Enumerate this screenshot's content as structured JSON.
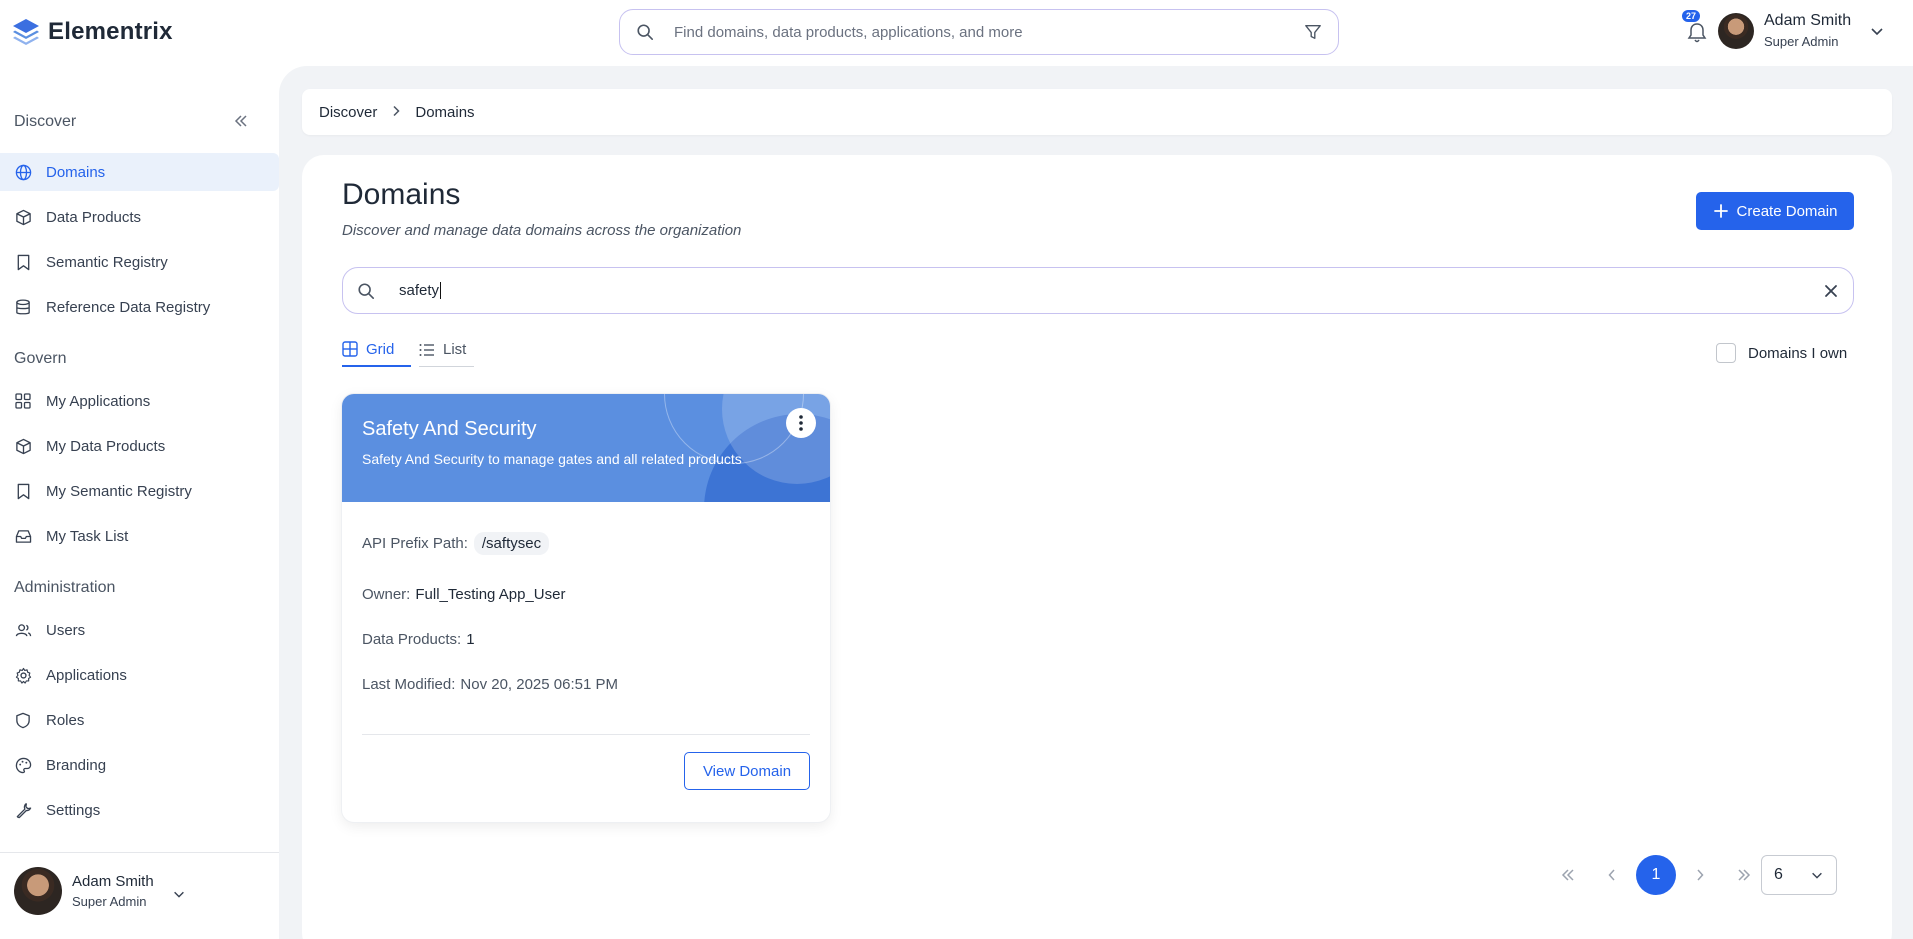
{
  "app": {
    "name": "Elementrix"
  },
  "global_search": {
    "placeholder": "Find domains, data products, applications, and more"
  },
  "notifications": {
    "count": "27"
  },
  "user": {
    "name": "Adam Smith",
    "role": "Super Admin"
  },
  "sidebar": {
    "sections": [
      {
        "title": "Discover"
      },
      {
        "title": "Govern"
      },
      {
        "title": "Administration"
      }
    ],
    "discover": [
      {
        "label": "Domains",
        "icon": "globe-icon",
        "active": true
      },
      {
        "label": "Data Products",
        "icon": "cube-icon"
      },
      {
        "label": "Semantic Registry",
        "icon": "bookmark-icon"
      },
      {
        "label": "Reference Data Registry",
        "icon": "database-icon"
      }
    ],
    "govern": [
      {
        "label": "My Applications",
        "icon": "apps-grid-icon"
      },
      {
        "label": "My Data Products",
        "icon": "cube-icon"
      },
      {
        "label": "My Semantic Registry",
        "icon": "bookmark-icon"
      },
      {
        "label": "My Task List",
        "icon": "inbox-icon"
      }
    ],
    "administration": [
      {
        "label": "Users",
        "icon": "users-icon"
      },
      {
        "label": "Applications",
        "icon": "gear-cog-icon"
      },
      {
        "label": "Roles",
        "icon": "shield-icon"
      },
      {
        "label": "Branding",
        "icon": "palette-icon"
      },
      {
        "label": "Settings",
        "icon": "wrench-icon"
      }
    ]
  },
  "breadcrumb": [
    "Discover",
    "Domains"
  ],
  "page": {
    "title": "Domains",
    "subtitle": "Discover and manage data domains across the organization",
    "create_label": "Create Domain"
  },
  "search": {
    "value": "safety"
  },
  "view_tabs": [
    {
      "label": "Grid",
      "active": true
    },
    {
      "label": "List",
      "active": false
    }
  ],
  "filter": {
    "own_label": "Domains I own",
    "checked": false
  },
  "cards": [
    {
      "title": "Safety And Security",
      "description": "Safety And Security to manage gates and all related products",
      "api_prefix_label": "API Prefix Path:",
      "api_prefix": "/saftysec",
      "owner_label": "Owner:",
      "owner": "Full_Testing App_User",
      "data_products_label": "Data Products:",
      "data_products": "1",
      "last_modified_label": "Last Modified:",
      "last_modified": "Nov 20, 2025 06:51 PM",
      "view_label": "View Domain"
    }
  ],
  "pagination": {
    "current_page": "1",
    "page_size": "6"
  },
  "colors": {
    "accent": "#2563eb",
    "card_header": "#5b8fe0",
    "active_nav_bg": "#eaf1fb"
  }
}
